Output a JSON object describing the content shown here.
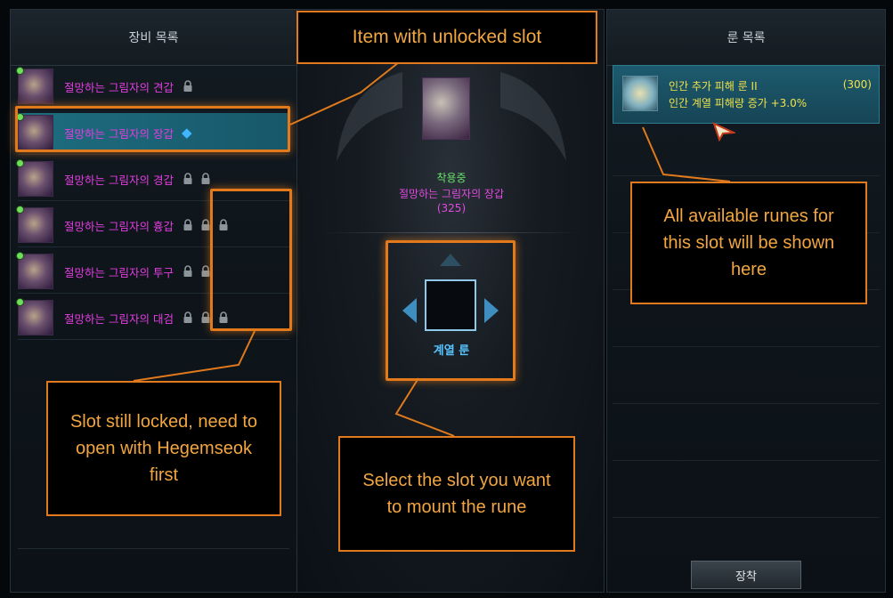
{
  "left_panel": {
    "title": "장비 목록",
    "items": [
      {
        "name": "절망하는 그림자의 견갑",
        "slot_state": "locked-1"
      },
      {
        "name": "절망하는 그림자의 장갑",
        "slot_state": "unlocked-1"
      },
      {
        "name": "절망하는 그림자의 경갑",
        "slot_state": "locked-2"
      },
      {
        "name": "절망하는 그림자의 흉갑",
        "slot_state": "locked-3"
      },
      {
        "name": "절망하는 그림자의 투구",
        "slot_state": "locked-2"
      },
      {
        "name": "절망하는 그림자의 대검",
        "slot_state": "locked-3"
      }
    ]
  },
  "center_panel": {
    "equipped_label": "착용중",
    "item_name": "절망하는 그림자의 장갑",
    "item_count": "(325)",
    "rune_slot_label": "계열 룬"
  },
  "right_panel": {
    "title": "룬 목록",
    "rune": {
      "name": "인간 추가 피해 룬 II",
      "count": "(300)",
      "effect": "인간 계열 피해량 증가 +3.0%"
    },
    "equip_button": "장착"
  },
  "callouts": {
    "unlocked_slot": "Item with unlocked slot",
    "locked_slot": "Slot still locked, need to open with Hegemseok first",
    "select_slot": "Select the slot you want to mount the rune",
    "available_runes": "All available runes for this slot will be shown here"
  },
  "colors": {
    "highlight": "#e27a1c",
    "callout_text": "#f2a640",
    "item_name": "#e43de0",
    "equipped": "#65e06b",
    "rune_text": "#f0e24a",
    "slot_diamond": "#3fb6ff"
  },
  "icons": {
    "lock": "lock-icon",
    "unlocked_slot": "diamond-icon",
    "cursor": "cursor-icon"
  }
}
